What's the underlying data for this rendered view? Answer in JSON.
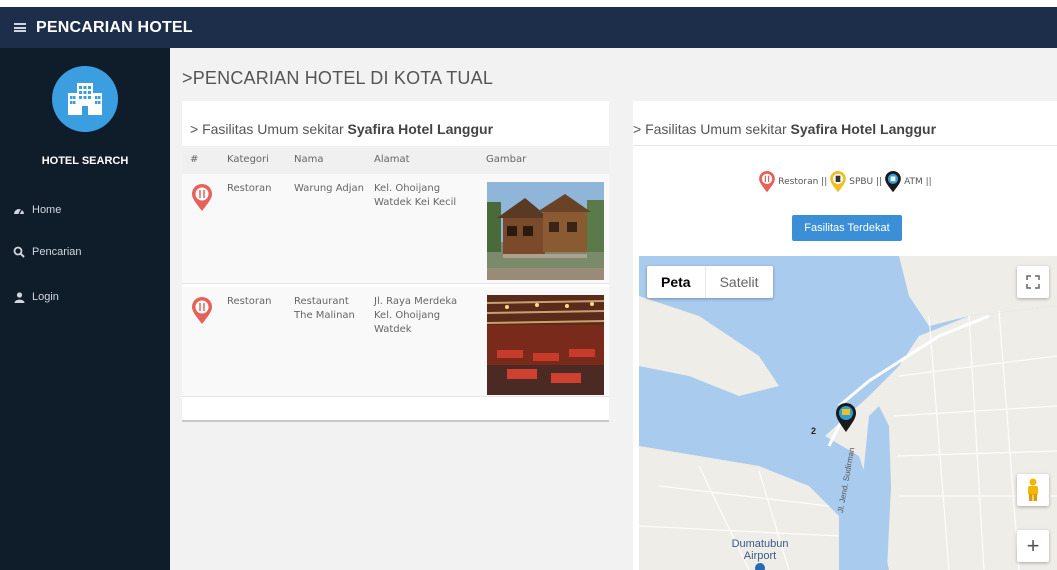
{
  "header": {
    "title": "PENCARIAN HOTEL"
  },
  "sidebar": {
    "brand": "HOTEL SEARCH",
    "items": [
      {
        "label": "Home",
        "icon": "dashboard-icon"
      },
      {
        "label": "Pencarian",
        "icon": "search-icon"
      },
      {
        "label": "Login",
        "icon": "user-icon"
      }
    ]
  },
  "page": {
    "title": ">PENCARIAN HOTEL DI KOTA TUAL"
  },
  "left_card": {
    "heading_prefix": "> Fasilitas Umum sekitar ",
    "heading_hotel": "Syafira Hotel Langgur",
    "columns": [
      "#",
      "Kategori",
      "Nama",
      "Alamat",
      "Gambar"
    ],
    "rows": [
      {
        "kategori": "Restoran",
        "nama": "Warung Adjan",
        "alamat": "Kel. Ohoijang Watdek Kei Kecil"
      },
      {
        "kategori": "Restoran",
        "nama": "Restaurant The Malinan",
        "alamat": "Jl. Raya Merdeka Kel. Ohoijang Watdek"
      }
    ]
  },
  "right_card": {
    "heading_prefix": "> Fasilitas Umum sekitar ",
    "heading_hotel": "Syafira Hotel Langgur",
    "legend": [
      {
        "label": "Restoran ||",
        "color": "#e8605a"
      },
      {
        "label": "SPBU ||",
        "color": "#f0c020"
      },
      {
        "label": "ATM ||",
        "color": "#2a9fd8"
      }
    ],
    "button_label": "Fasilitas Terdekat"
  },
  "map": {
    "type_options": [
      "Peta",
      "Satelit"
    ],
    "selected_type": "Peta",
    "cluster_count": "2",
    "road_label": "Jl. Jend. Sudirman",
    "airport_label": "Dumatubun Airport",
    "zoom_in_label": "+"
  },
  "colors": {
    "topbar": "#1c2e4a",
    "sidebar": "#0f1c2a",
    "accent": "#3b8fd6"
  }
}
